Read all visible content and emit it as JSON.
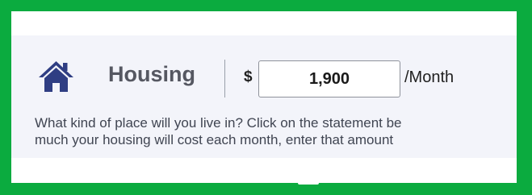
{
  "section": {
    "icon": "home-icon",
    "title": "Housing",
    "currency_symbol": "$",
    "amount_value": "1,900",
    "unit_label": "/Month",
    "instructions_line1": "What kind of place will you live in? Click on the statement be",
    "instructions_line2": "much your housing will cost each month, enter that amount"
  },
  "colors": {
    "frame_border": "#0bab3f",
    "panel_background": "#f3f4fa",
    "icon_color": "#2f3e83",
    "title_color": "#555761"
  }
}
